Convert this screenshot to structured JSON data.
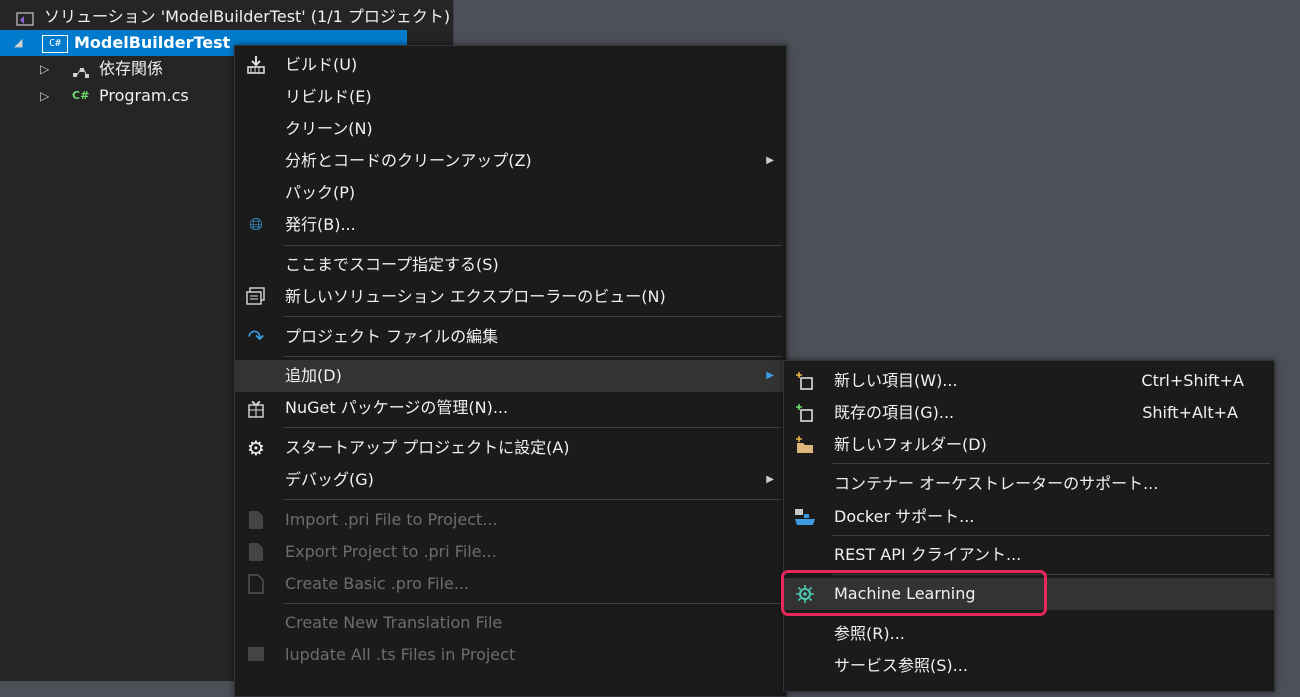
{
  "explorer": {
    "solution_label": "ソリューション 'ModelBuilderTest' (1/1 プロジェクト)",
    "project_label": "ModelBuilderTest",
    "project_icon": "C#",
    "deps_label": "依存関係",
    "program_label": "Program.cs",
    "program_icon": "C#"
  },
  "context_menu": {
    "build": "ビルド(U)",
    "rebuild": "リビルド(E)",
    "clean": "クリーン(N)",
    "analyze": "分析とコードのクリーンアップ(Z)",
    "pack": "パック(P)",
    "publish": "発行(B)...",
    "scope": "ここまでスコープ指定する(S)",
    "new_view": "新しいソリューション エクスプローラーのビュー(N)",
    "edit_project": "プロジェクト ファイルの編集",
    "add": "追加(D)",
    "nuget": "NuGet パッケージの管理(N)...",
    "startup": "スタートアップ プロジェクトに設定(A)",
    "debug": "デバッグ(G)",
    "import_pri": "Import .pri File to Project...",
    "export_pri": "Export Project to .pri File...",
    "create_pro": "Create Basic .pro File...",
    "new_translation": "Create New Translation File",
    "lupdate": "lupdate All .ts Files in Project"
  },
  "sub_menu": {
    "new_item": "新しい項目(W)...",
    "new_item_shortcut": "Ctrl+Shift+A",
    "existing_item": "既存の項目(G)...",
    "existing_item_shortcut": "Shift+Alt+A",
    "new_folder": "新しいフォルダー(D)",
    "orchestrator": "コンテナー オーケストレーターのサポート...",
    "docker": "Docker サポート...",
    "rest_api": "REST API クライアント...",
    "ml": "Machine Learning",
    "reference": "参照(R)...",
    "service_ref": "サービス参照(S)..."
  },
  "colors": {
    "selection": "#007acc",
    "highlight_border": "#e8285a",
    "menu_bg": "#1b1b1c"
  }
}
